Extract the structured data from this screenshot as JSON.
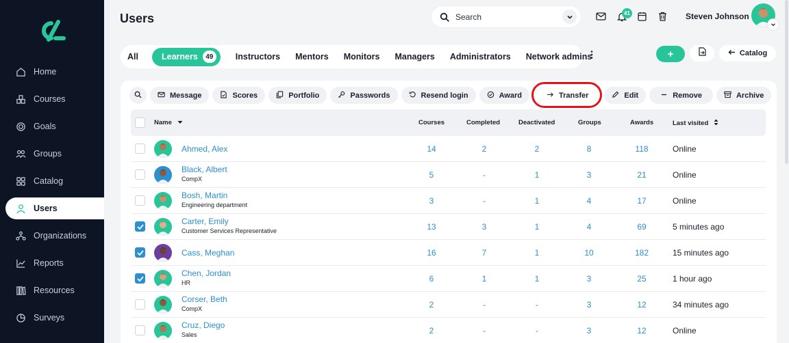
{
  "page": {
    "title": "Users"
  },
  "sidebar": {
    "items": [
      {
        "label": "Home",
        "icon": "home-icon"
      },
      {
        "label": "Courses",
        "icon": "courses-icon"
      },
      {
        "label": "Goals",
        "icon": "goals-icon"
      },
      {
        "label": "Groups",
        "icon": "groups-icon"
      },
      {
        "label": "Catalog",
        "icon": "catalog-icon"
      },
      {
        "label": "Users",
        "icon": "user-icon",
        "active": true
      },
      {
        "label": "Organizations",
        "icon": "organizations-icon"
      },
      {
        "label": "Reports",
        "icon": "reports-icon"
      },
      {
        "label": "Resources",
        "icon": "resources-icon"
      },
      {
        "label": "Surveys",
        "icon": "surveys-icon"
      }
    ]
  },
  "header": {
    "search_placeholder": "Search",
    "notification_count": "41",
    "user_name": "Steven Johnson"
  },
  "tabs": [
    {
      "label": "All"
    },
    {
      "label": "Learners",
      "count": "49",
      "active": true
    },
    {
      "label": "Instructors"
    },
    {
      "label": "Mentors"
    },
    {
      "label": "Monitors"
    },
    {
      "label": "Managers"
    },
    {
      "label": "Administrators"
    },
    {
      "label": "Network admins"
    }
  ],
  "toolbar": {
    "catalog_label": "Catalog",
    "add_label": "+"
  },
  "actions": [
    {
      "label": "Message",
      "icon": "mail-icon"
    },
    {
      "label": "Scores",
      "icon": "scores-icon"
    },
    {
      "label": "Portfolio",
      "icon": "portfolio-icon"
    },
    {
      "label": "Passwords",
      "icon": "key-icon"
    },
    {
      "label": "Resend login",
      "icon": "resend-icon"
    },
    {
      "label": "Award",
      "icon": "award-icon"
    },
    {
      "label": "Transfer",
      "icon": "arrow-right-icon"
    },
    {
      "label": "Edit",
      "icon": "pencil-icon"
    },
    {
      "label": "Remove",
      "icon": "minus-icon"
    },
    {
      "label": "Archive",
      "icon": "archive-icon"
    }
  ],
  "table": {
    "headers": {
      "name": "Name",
      "courses": "Courses",
      "completed": "Completed",
      "deactivated": "Deactivated",
      "groups": "Groups",
      "awards": "Awards",
      "last_visited": "Last visited"
    },
    "rows": [
      {
        "name": "Ahmed, Alex",
        "sub": "",
        "courses": "14",
        "completed": "2",
        "deactivated": "2",
        "groups": "8",
        "awards": "118",
        "last_visited": "Online",
        "checked": false
      },
      {
        "name": "Black, Albert",
        "sub": "CompX",
        "courses": "5",
        "completed": "-",
        "deactivated": "1",
        "groups": "3",
        "awards": "21",
        "last_visited": "Online",
        "checked": false
      },
      {
        "name": "Bosh, Martin",
        "sub": "Engineering department",
        "courses": "3",
        "completed": "-",
        "deactivated": "1",
        "groups": "4",
        "awards": "17",
        "last_visited": "Online",
        "checked": false
      },
      {
        "name": "Carter, Emily",
        "sub": "Customer Services Representative",
        "courses": "13",
        "completed": "3",
        "deactivated": "1",
        "groups": "4",
        "awards": "69",
        "last_visited": "5 minutes ago",
        "checked": true
      },
      {
        "name": "Cass, Meghan",
        "sub": "",
        "courses": "16",
        "completed": "7",
        "deactivated": "1",
        "groups": "10",
        "awards": "182",
        "last_visited": "15 minutes ago",
        "checked": true
      },
      {
        "name": "Chen, Jordan",
        "sub": "HR",
        "courses": "6",
        "completed": "1",
        "deactivated": "1",
        "groups": "3",
        "awards": "25",
        "last_visited": "1 hour ago",
        "checked": true
      },
      {
        "name": "Corser, Beth",
        "sub": "CompX",
        "courses": "2",
        "completed": "-",
        "deactivated": "-",
        "groups": "3",
        "awards": "12",
        "last_visited": "34 minutes ago",
        "checked": false
      },
      {
        "name": "Cruz, Diego",
        "sub": "Sales",
        "courses": "2",
        "completed": "-",
        "deactivated": "-",
        "groups": "3",
        "awards": "12",
        "last_visited": "Online",
        "checked": false
      }
    ]
  },
  "colors": {
    "accent": "#29c59a",
    "link": "#2d8fd0",
    "sidebar_bg": "#0d1424",
    "highlight": "#e6121a"
  }
}
